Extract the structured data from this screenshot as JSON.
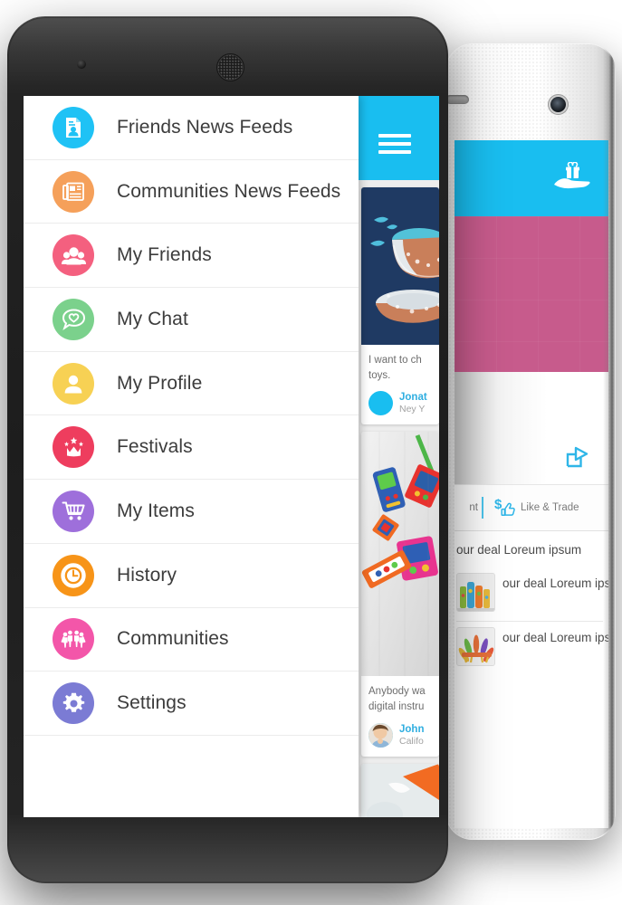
{
  "app": {
    "accent_blue": "#19BEF0",
    "drawer_bg": "#FFFFFF"
  },
  "front_phone": {
    "header": {
      "menu_icon": "hamburger-icon",
      "background": "#19BEF0"
    },
    "drawer": {
      "items": [
        {
          "label": "Friends News Feeds",
          "icon": "news-document-icon",
          "color": "#1FC2F5"
        },
        {
          "label": "Communities News Feeds",
          "icon": "newspaper-icon",
          "color": "#F5A05A"
        },
        {
          "label": "My Friends",
          "icon": "people-group-icon",
          "color": "#F4607F"
        },
        {
          "label": "My Chat",
          "icon": "heart-chat-icon",
          "color": "#7BD18C"
        },
        {
          "label": "My Profile",
          "icon": "person-icon",
          "color": "#F7D154"
        },
        {
          "label": "Festivals",
          "icon": "crown-star-icon",
          "color": "#EE3D5E"
        },
        {
          "label": "My Items",
          "icon": "shopping-cart-icon",
          "color": "#9E6FDB"
        },
        {
          "label": "History",
          "icon": "clock-icon",
          "color": "#F79418"
        },
        {
          "label": "Communities",
          "icon": "community-icon",
          "color": "#F356A9"
        },
        {
          "label": "Settings",
          "icon": "gear-icon",
          "color": "#7B7BD4"
        }
      ]
    },
    "feed": {
      "cards": [
        {
          "image": "teacup-illustration",
          "text_line1": "I want to ch",
          "text_line2": "toys.",
          "author": "Jonat",
          "location": "Ney Y",
          "avatar": "avatar-placeholder-blue"
        },
        {
          "image": "colorful-toys-photo",
          "text_line1": "Anybody wa",
          "text_line2": "digital instru",
          "author": "John",
          "location": "Califo",
          "avatar": "avatar-boy-photo"
        },
        {
          "image": "orange-object-photo",
          "text_line1": "",
          "text_line2": "",
          "author": "",
          "location": "",
          "avatar": ""
        }
      ]
    }
  },
  "back_phone": {
    "header": {
      "background": "#19BEF0",
      "icon": "gift-in-hand-icon"
    },
    "hero": {
      "background": "#C75B8C"
    },
    "share_icon": "share-icon",
    "action_bar": {
      "comment_label": "nt",
      "like_trade_label": "Like & Trade",
      "like_trade_icon": "dollar-thumbs-up-icon"
    },
    "comments": [
      {
        "text": "our deal Loreum ipsum",
        "thumb": ""
      },
      {
        "text": "our deal Loreum ipsum is",
        "thumb": "colorful-bottles-photo"
      },
      {
        "text": "our deal Loreum ipsum is",
        "thumb": "feather-headdress-photo"
      }
    ]
  }
}
